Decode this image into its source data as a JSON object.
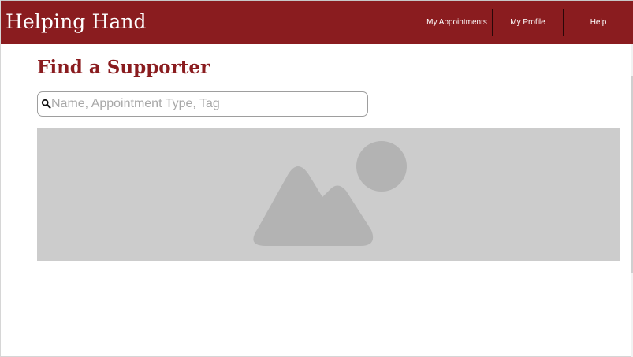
{
  "header": {
    "brand": "Helping Hand",
    "nav": [
      {
        "label": "My Appointments"
      },
      {
        "label": "My Profile"
      },
      {
        "label": "Help"
      }
    ]
  },
  "main": {
    "title": "Find a Supporter",
    "search": {
      "placeholder": "Name, Appointment Type, Tag",
      "value": ""
    },
    "hero_image": {
      "icon": "image-placeholder-icon"
    }
  },
  "colors": {
    "brand": "#8a1c1f",
    "placeholder_bg": "#cccccc",
    "placeholder_shape": "#b3b3b3"
  }
}
